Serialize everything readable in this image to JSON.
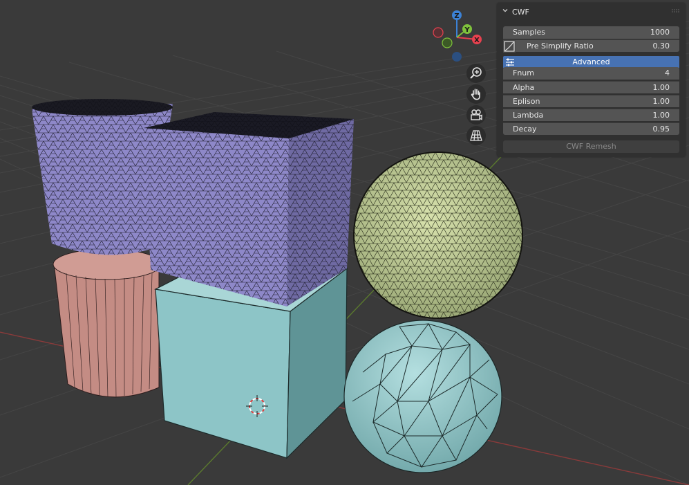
{
  "panel": {
    "title": "CWF",
    "rows": [
      {
        "label": "Samples",
        "value": "1000"
      },
      {
        "label": "Pre Simplify Ratio",
        "value": "0.30"
      }
    ],
    "advanced_label": "Advanced",
    "params": [
      {
        "label": "Fnum",
        "value": "4"
      },
      {
        "label": "Alpha",
        "value": "1.00"
      },
      {
        "label": "Eplison",
        "value": "1.00"
      },
      {
        "label": "Lambda",
        "value": "1.00"
      },
      {
        "label": "Decay",
        "value": "0.95"
      }
    ],
    "remesh_button": "CWF Remesh"
  },
  "gizmo": {
    "x_label": "X",
    "y_label": "Y",
    "z_label": "Z",
    "x_color": "#e9414f",
    "y_color": "#7fc23c",
    "z_color": "#3c82d6"
  },
  "nav_buttons": [
    "zoom-icon",
    "hand-pan-icon",
    "camera-icon",
    "grid-ortho-icon"
  ],
  "colors": {
    "viewport_bg": "#3a3a3a",
    "purple_mesh": "#8e88c9",
    "pink_cylinder": "#c48c84",
    "teal_object": "#8dc5c7",
    "green_sphere": "#c2cf98",
    "highlight_blue": "#4772b3"
  }
}
